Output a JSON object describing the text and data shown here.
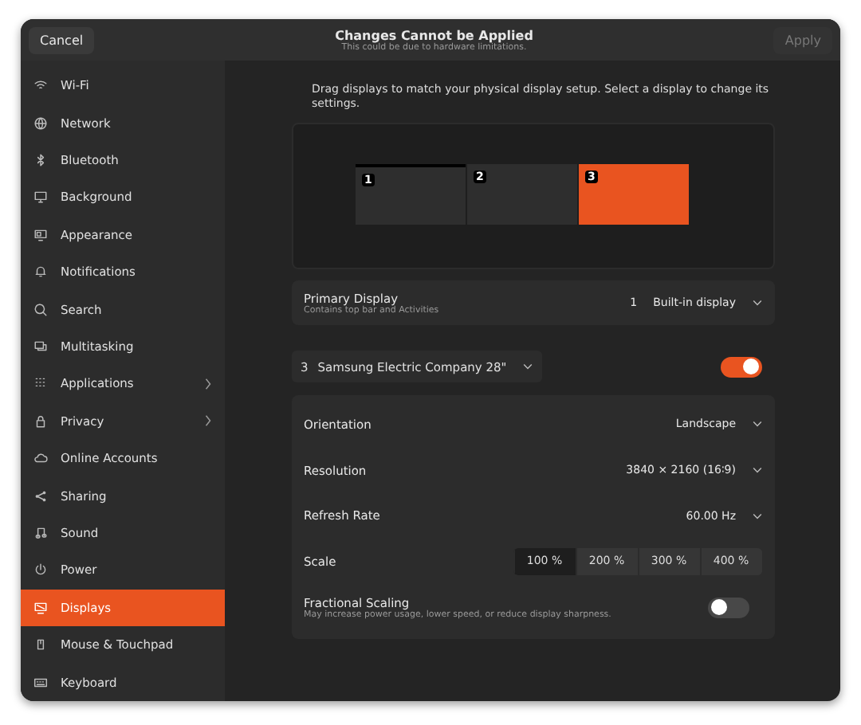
{
  "header": {
    "cancel": "Cancel",
    "title": "Changes Cannot be Applied",
    "subtitle": "This could be due to hardware limitations.",
    "apply": "Apply",
    "apply_disabled": true
  },
  "sidebar": {
    "items": [
      {
        "label": "Wi-Fi",
        "selected": false,
        "submenu": false
      },
      {
        "label": "Network",
        "selected": false,
        "submenu": false
      },
      {
        "label": "Bluetooth",
        "selected": false,
        "submenu": false
      },
      {
        "label": "Background",
        "selected": false,
        "submenu": false
      },
      {
        "label": "Appearance",
        "selected": false,
        "submenu": false
      },
      {
        "label": "Notifications",
        "selected": false,
        "submenu": false
      },
      {
        "label": "Search",
        "selected": false,
        "submenu": false
      },
      {
        "label": "Multitasking",
        "selected": false,
        "submenu": false
      },
      {
        "label": "Applications",
        "selected": false,
        "submenu": true
      },
      {
        "label": "Privacy",
        "selected": false,
        "submenu": true
      },
      {
        "label": "Online Accounts",
        "selected": false,
        "submenu": false
      },
      {
        "label": "Sharing",
        "selected": false,
        "submenu": false
      },
      {
        "label": "Sound",
        "selected": false,
        "submenu": false
      },
      {
        "label": "Power",
        "selected": false,
        "submenu": false
      },
      {
        "label": "Displays",
        "selected": true,
        "submenu": false
      },
      {
        "label": "Mouse & Touchpad",
        "selected": false,
        "submenu": false
      },
      {
        "label": "Keyboard",
        "selected": false,
        "submenu": false
      }
    ]
  },
  "intro": "Drag displays to match your physical display setup. Select a display to change its settings.",
  "arrangement": {
    "displays": [
      {
        "number": "1",
        "primary": true,
        "selected": false
      },
      {
        "number": "2",
        "primary": false,
        "selected": false
      },
      {
        "number": "3",
        "primary": false,
        "selected": true
      }
    ]
  },
  "primary_display": {
    "label": "Primary Display",
    "hint": "Contains top bar and Activities",
    "number": "1",
    "value": "Built-in display"
  },
  "monitor": {
    "number": "3",
    "name": "Samsung Electric Company 28\"",
    "enabled": true
  },
  "settings": [
    {
      "kind": "dropdown",
      "label": "Orientation",
      "value": "Landscape"
    },
    {
      "kind": "dropdown",
      "label": "Resolution",
      "value": "3840 × 2160 (16∶9)"
    },
    {
      "kind": "dropdown",
      "label": "Refresh Rate",
      "value": "60.00 Hz"
    },
    {
      "kind": "segmented",
      "label": "Scale",
      "options": [
        {
          "label": "100 %",
          "selected": true
        },
        {
          "label": "200 %",
          "selected": false
        },
        {
          "label": "300 %",
          "selected": false
        },
        {
          "label": "400 %",
          "selected": false
        }
      ]
    },
    {
      "kind": "switch",
      "label": "Fractional Scaling",
      "hint": "May increase power usage, lower speed, or reduce display sharpness.",
      "on": false
    }
  ]
}
